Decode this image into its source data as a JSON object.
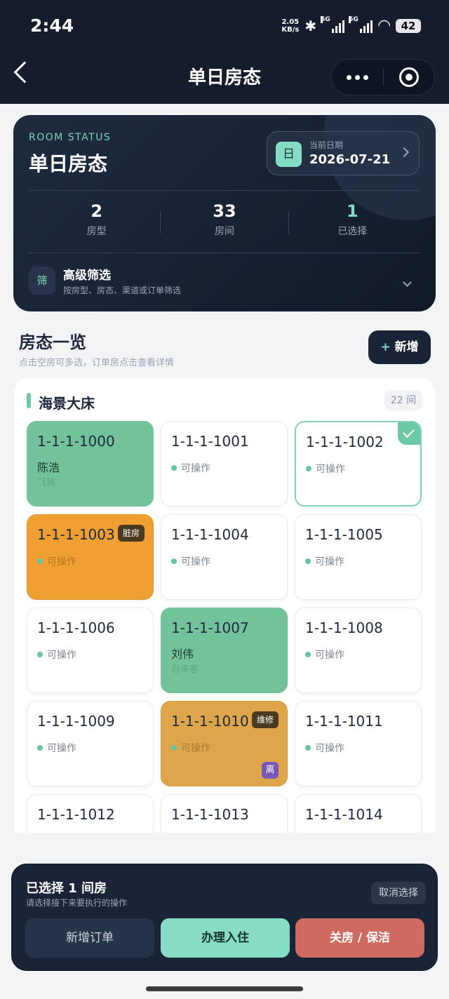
{
  "status_bar": {
    "time": "2:44",
    "speed": "2.05",
    "speed_unit": "KB/s",
    "network_1": "5G",
    "network_2": "5G",
    "battery": "42"
  },
  "nav": {
    "title": "单日房态"
  },
  "hero": {
    "eyebrow": "ROOM STATUS",
    "title": "单日房态",
    "date_badge": "日",
    "date_label": "当前日期",
    "date_value": "2026-07-21",
    "stats": [
      {
        "value": "2",
        "label": "房型"
      },
      {
        "value": "33",
        "label": "房间"
      },
      {
        "value": "1",
        "label": "已选择"
      }
    ],
    "filter": {
      "icon_text": "筛",
      "title": "高级筛选",
      "subtitle": "按房型、房态、渠道或订单筛选"
    }
  },
  "section": {
    "title": "房态一览",
    "subtitle": "点击空房可多选，订单房点击查看详情",
    "add_label": "新增",
    "add_plus": "+"
  },
  "group": {
    "name": "海景大床",
    "count": "22 间",
    "rooms": [
      {
        "number": "1-1-1-1000",
        "guest": "陈浩",
        "source": "飞猪"
      },
      {
        "number": "1-1-1-1001",
        "status": "可操作"
      },
      {
        "number": "1-1-1-1002",
        "status": "可操作"
      },
      {
        "number": "1-1-1-1003",
        "status": "可操作",
        "tag": "脏房"
      },
      {
        "number": "1-1-1-1004",
        "status": "可操作"
      },
      {
        "number": "1-1-1-1005",
        "status": "可操作"
      },
      {
        "number": "1-1-1-1006",
        "status": "可操作"
      },
      {
        "number": "1-1-1-1007",
        "guest": "刘伟",
        "source": "自来客"
      },
      {
        "number": "1-1-1-1008",
        "status": "可操作"
      },
      {
        "number": "1-1-1-1009",
        "status": "可操作"
      },
      {
        "number": "1-1-1-1010",
        "status": "可操作",
        "tag": "维修",
        "badge": "离"
      },
      {
        "number": "1-1-1-1011",
        "status": "可操作"
      },
      {
        "number": "1-1-1-1012"
      },
      {
        "number": "1-1-1-1013"
      },
      {
        "number": "1-1-1-1014"
      }
    ]
  },
  "bottom": {
    "title": "已选择 1 间房",
    "subtitle": "请选择接下来要执行的操作",
    "cancel": "取消选择",
    "actions": [
      "新增订单",
      "办理入住",
      "关房 / 保洁"
    ]
  },
  "colors": {
    "accent": "#83dcc3",
    "dark": "#151c2c",
    "occupied": "#72c39b",
    "dirty": "#f0a033",
    "repair": "#dea54a",
    "close": "#cf6a61"
  }
}
